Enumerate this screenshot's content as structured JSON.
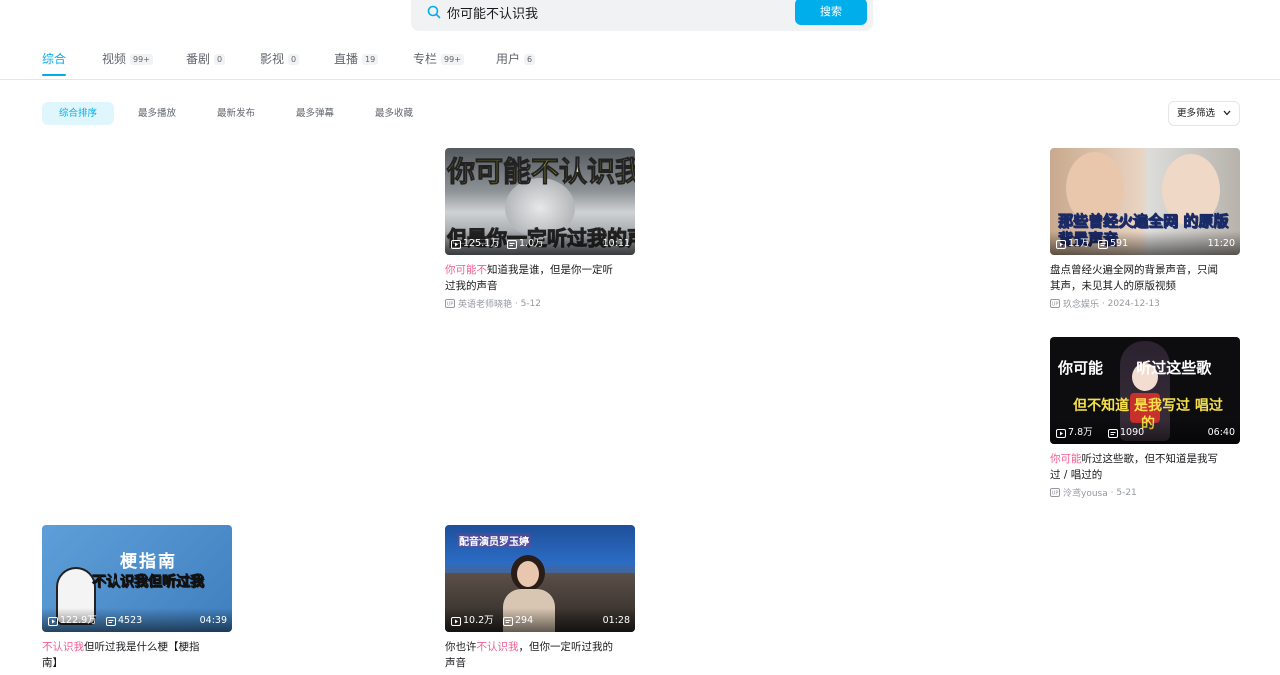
{
  "search": {
    "query": "你可能不认识我",
    "button_label": "搜索"
  },
  "tabs": [
    {
      "label": "综合",
      "count": ""
    },
    {
      "label": "视频",
      "count": "99+"
    },
    {
      "label": "番剧",
      "count": "0"
    },
    {
      "label": "影视",
      "count": "0"
    },
    {
      "label": "直播",
      "count": "19"
    },
    {
      "label": "专栏",
      "count": "99+"
    },
    {
      "label": "用户",
      "count": "6"
    }
  ],
  "sort": {
    "options": [
      "综合排序",
      "最多播放",
      "最新发布",
      "最多弹幕",
      "最多收藏"
    ],
    "active": "综合排序",
    "more_filter": "更多筛选"
  },
  "videos": [
    {
      "thumb_text_top": "你可能不认识我",
      "thumb_text_bottom": "但是你一定听过我的声音",
      "plays": "125.1万",
      "danmaku": "1.0万",
      "duration": "10:11",
      "title_pre": "",
      "title_hl": "你可能不",
      "title_post": "知道我是谁，但是你一定听过我的声音",
      "author": "英语老师晓艳",
      "date": "5-12"
    },
    {
      "thumb_text_top": "",
      "thumb_text_bottom": "那些曾经火遍全网 的原版背景声音",
      "plays": "11万",
      "danmaku": "591",
      "duration": "11:20",
      "title_pre": "",
      "title_hl": "",
      "title_post": "盘点曾经火遍全网的背景声音，只闻其声，未见其人的原版视频",
      "author": "玖念娱乐",
      "date": "2024-12-13"
    },
    {
      "thumb_text_top": "你可能 听过这些歌",
      "thumb_text_bottom": "但不知道 是我写过 唱过的",
      "plays": "7.8万",
      "danmaku": "1090",
      "duration": "06:40",
      "title_pre": "",
      "title_hl": "你可能",
      "title_post": "听过这些歌，但不知道是我写过 / 唱过的",
      "author": "泠鸢yousa",
      "date": "5-21"
    },
    {
      "thumb_text_top": "梗指南",
      "thumb_text_bottom": "不认识我但听过我",
      "plays": "122.9万",
      "danmaku": "4523",
      "duration": "04:39",
      "title_pre": "",
      "title_hl": "不认识我",
      "title_post": "但听过我是什么梗【梗指南】",
      "author": "",
      "date": ""
    },
    {
      "thumb_text_top": "配音演员罗玉婷",
      "thumb_text_bottom": "",
      "plays": "10.2万",
      "danmaku": "294",
      "duration": "01:28",
      "title_pre": "你也许",
      "title_hl": "不认识我",
      "title_post": "，但你一定听过我的声音",
      "author": "",
      "date": ""
    }
  ],
  "colors": {
    "accent": "#00aeec",
    "highlight": "#f25d8e",
    "muted": "#9499a0"
  }
}
